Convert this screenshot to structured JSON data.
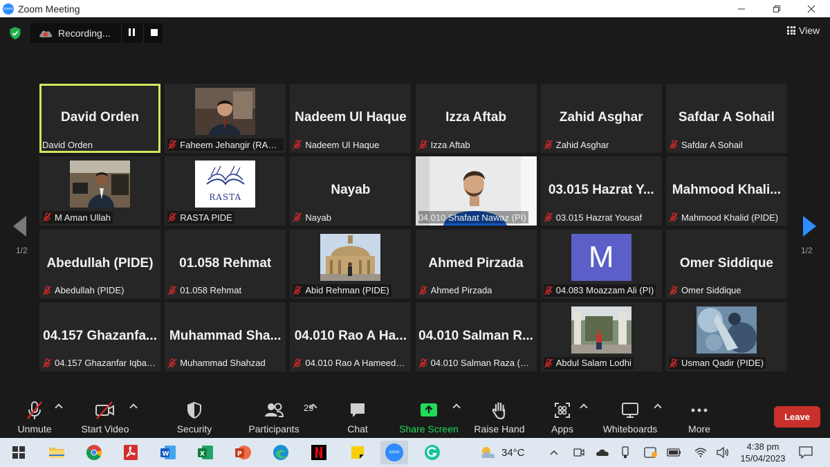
{
  "window": {
    "title": "Zoom Meeting",
    "logo_text": "zoom"
  },
  "recording": {
    "label": "Recording..."
  },
  "view": {
    "label": "View"
  },
  "pagination": {
    "left": "1/2",
    "right": "1/2"
  },
  "tiles": [
    {
      "big": "David Orden",
      "label": "David Orden",
      "muted": false,
      "kind": "name",
      "active": true
    },
    {
      "big": "",
      "label": "Faheem Jehangir (RASTA)",
      "muted": true,
      "kind": "photo-man"
    },
    {
      "big": "Nadeem Ul Haque",
      "label": "Nadeem Ul Haque",
      "muted": true,
      "kind": "name"
    },
    {
      "big": "Izza Aftab",
      "label": "Izza Aftab",
      "muted": true,
      "kind": "name"
    },
    {
      "big": "Zahid Asghar",
      "label": "Zahid Asghar",
      "muted": true,
      "kind": "name"
    },
    {
      "big": "Safdar A Sohail",
      "label": "Safdar A Sohail",
      "muted": true,
      "kind": "name"
    },
    {
      "big": "",
      "label": "M Aman Ullah",
      "muted": true,
      "kind": "photo-office"
    },
    {
      "big": "",
      "label": "RASTA PIDE",
      "muted": true,
      "kind": "logo-rasta",
      "logo_text": "RASTA"
    },
    {
      "big": "Nayab",
      "label": "Nayab",
      "muted": true,
      "kind": "name"
    },
    {
      "big": "",
      "label": "04.010 Shafaat Nawaz (PI)",
      "muted": false,
      "kind": "video"
    },
    {
      "big": "03.015 Hazrat Y...",
      "label": "03.015 Hazrat Yousaf",
      "muted": true,
      "kind": "name"
    },
    {
      "big": "Mahmood Khali...",
      "label": "Mahmood Khalid (PIDE)",
      "muted": true,
      "kind": "name"
    },
    {
      "big": "Abedullah (PIDE)",
      "label": "Abedullah (PIDE)",
      "muted": true,
      "kind": "name"
    },
    {
      "big": "01.058 Rehmat",
      "label": "01.058 Rehmat",
      "muted": true,
      "kind": "name"
    },
    {
      "big": "",
      "label": "Abid Rehman (PIDE)",
      "muted": true,
      "kind": "photo-building"
    },
    {
      "big": "Ahmed Pirzada",
      "label": "Ahmed Pirzada",
      "muted": true,
      "kind": "name"
    },
    {
      "big": "",
      "label": "04.083 Moazzam Ali (PI)",
      "muted": true,
      "kind": "avatar-letter",
      "letter": "M"
    },
    {
      "big": "Omer Siddique",
      "label": "Omer Siddique",
      "muted": true,
      "kind": "name"
    },
    {
      "big": "04.157 Ghazanfa...",
      "label": "04.157 Ghazanfar Iqbal ...",
      "muted": true,
      "kind": "name"
    },
    {
      "big": "Muhammad Sha...",
      "label": "Muhammad Shahzad",
      "muted": true,
      "kind": "name"
    },
    {
      "big": "04.010 Rao A Ha...",
      "label": "04.010 Rao A Hameed (...",
      "muted": true,
      "kind": "name"
    },
    {
      "big": "04.010 Salman R...",
      "label": "04.010 Salman Raza (RA)",
      "muted": true,
      "kind": "name"
    },
    {
      "big": "",
      "label": "Abdul Salam Lodhi",
      "muted": true,
      "kind": "photo-street"
    },
    {
      "big": "",
      "label": "Usman Qadir (PIDE)",
      "muted": true,
      "kind": "photo-abstract"
    }
  ],
  "toolbar": {
    "unmute": "Unmute",
    "start_video": "Start Video",
    "security": "Security",
    "participants": "Participants",
    "participants_count": "29",
    "chat": "Chat",
    "share_screen": "Share Screen",
    "raise_hand": "Raise Hand",
    "apps": "Apps",
    "whiteboards": "Whiteboards",
    "more": "More",
    "leave": "Leave"
  },
  "taskbar": {
    "weather": "34°C",
    "time": "4:38 pm",
    "date": "15/04/2023",
    "zoom_label": "zoom"
  },
  "colors": {
    "accent_blue": "#2d8cff",
    "active_speaker": "#d1e85c",
    "share_green": "#23d959",
    "leave_red": "#c9302c",
    "muted_red": "#e02828"
  }
}
